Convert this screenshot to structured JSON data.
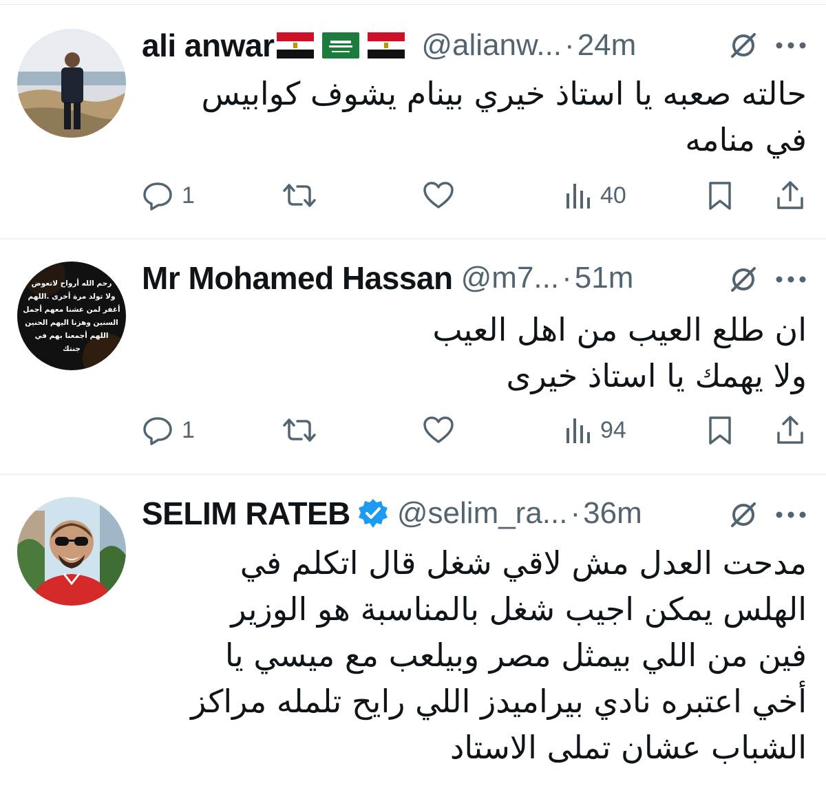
{
  "tweets": [
    {
      "display_name": "ali anwar",
      "handle": "@alianw...",
      "dot": "·",
      "time": "24m",
      "body_lines": [
        "حالته صعبه يا استاذ خيري بينام يشوف كوابيس",
        "في منامه"
      ],
      "replies": "1",
      "views": "40",
      "flags": [
        "egypt-flag",
        "saudi-flag",
        "egypt-flag"
      ]
    },
    {
      "display_name": "Mr Mohamed Hassan",
      "handle": "@m7...",
      "dot": "·",
      "time": "51m",
      "body_lines": [
        "ان طلع العيب من اهل العيب",
        "ولا يهمك يا استاذ خيرى"
      ],
      "replies": "1",
      "views": "94",
      "avatar_text": [
        "رحم الله أرواح لاتعوض",
        "ولا تولد مرة أخرى .اللهم",
        "أغفر لمن عشنا معهم أجمل",
        "السنين وهزنا اليهم الحنين",
        "اللهم أجمعنا بهم في",
        "جنتك"
      ]
    },
    {
      "display_name": "SELIM RATEB",
      "handle": "@selim_ra...",
      "dot": "·",
      "time": "36m",
      "verified": true,
      "body_lines": [
        "مدحت العدل مش لاقي شغل قال اتكلم في",
        "الهلس يمكن اجيب شغل بالمناسبة هو الوزير",
        "فين من اللي بيمثل مصر وبيلعب مع ميسي يا",
        "أخي اعتبره نادي بيراميدز اللي رايح تلمله مراكز",
        "الشباب عشان تملى الاستاد"
      ]
    }
  ],
  "colors": {
    "text": "#0f1419",
    "secondary": "#536471",
    "verified": "#1d9bf0",
    "divider": "#eff3f4"
  },
  "icons": [
    "reply-icon",
    "retweet-icon",
    "like-icon",
    "views-icon",
    "bookmark-icon",
    "share-icon",
    "grok-icon",
    "more-icon"
  ]
}
